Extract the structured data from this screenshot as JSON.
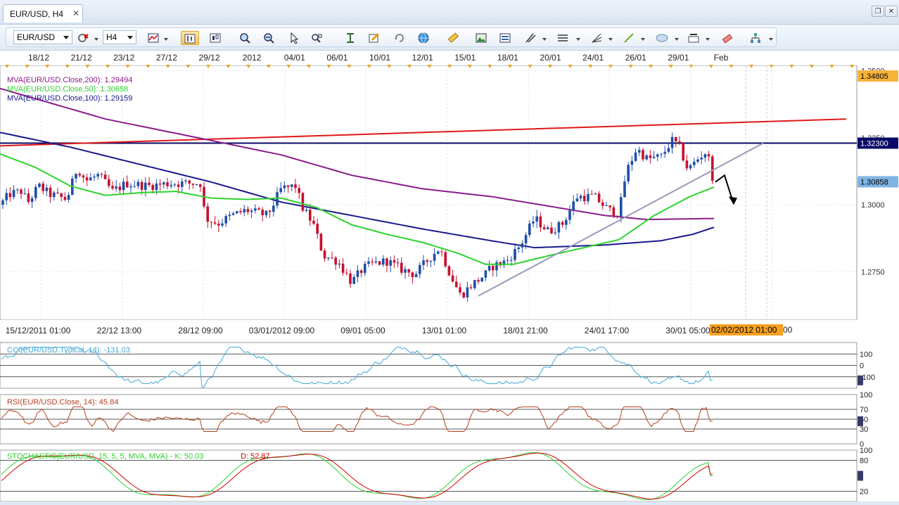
{
  "window": {
    "tab_label": "EUR/USD, H4",
    "close_glyph": "✕",
    "restore_glyph": "❐",
    "close_win_glyph": "✕"
  },
  "toolbar": {
    "symbol": "EUR/USD",
    "timeframe": "H4",
    "icons": [
      "indicator-icon",
      "crosshair-remove-icon",
      "chart-style-icon",
      "bar-chart-icon",
      "candle-chart-icon",
      "zoom-in-icon",
      "zoom-out-icon",
      "cursor-icon",
      "zoom-area-icon",
      "fit-icon",
      "edit-icon",
      "refresh-icon",
      "globe-icon",
      "ruler-icon",
      "picture-icon",
      "template-icon",
      "line-tools-icon",
      "hline-icon",
      "fan-icon",
      "trendline-icon",
      "ellipse-icon",
      "text-icon",
      "eraser-icon",
      "layout-icon"
    ]
  },
  "chart_data": [
    {
      "type": "candlestick",
      "symbol": "EUR/USD",
      "timeframe": "H4",
      "ylim": [
        1.257,
        1.352
      ],
      "y_ticks": [
        "1.2750",
        "1.3000",
        "1.3250",
        "1.3500"
      ],
      "top_dates": [
        "18/12",
        "21/12",
        "23/12",
        "27/12",
        "29/12",
        "2012",
        "04/01",
        "06/01",
        "10/01",
        "12/01",
        "15/01",
        "18/01",
        "20/01",
        "24/01",
        "26/01",
        "29/01",
        "Feb"
      ],
      "bottom_dates": [
        "15/12/2011 01:00",
        "22/12 13:00",
        "28/12 09:00",
        "03/01/2012 09:00",
        "09/01 05:00",
        "13/01 01:00",
        "18/01 21:00",
        "24/01 17:00",
        "30/01 05:00"
      ],
      "cursor_time_label": "02/02/2012 01:00",
      "price_labels": [
        {
          "value": "1.34805",
          "color": "#f7b33a"
        },
        {
          "value": "1.32300",
          "color": "#0a0a66"
        },
        {
          "value": "1.30858",
          "color": "#7fb3e3"
        }
      ],
      "indicators": [
        {
          "label": "MVA(EUR/USD.Close,200): 1.29494",
          "color": "#8b1c8b"
        },
        {
          "label": "MVA(EUR/USD.Close,50): 1.30658",
          "color": "#2fd12f"
        },
        {
          "label": "MVA(EUR/USD.Close,100): 1.29159",
          "color": "#1a1a8c"
        }
      ],
      "horizontal_line": 1.323,
      "red_line": {
        "start": 1.322,
        "end": 1.332
      },
      "ohlc_keyframes": [
        [
          0,
          1.3
        ],
        [
          14,
          1.304
        ],
        [
          30,
          1.305
        ],
        [
          40,
          1.301
        ],
        [
          55,
          1.307
        ],
        [
          70,
          1.304
        ],
        [
          95,
          1.302
        ],
        [
          110,
          1.314
        ],
        [
          122,
          1.309
        ],
        [
          140,
          1.311
        ],
        [
          160,
          1.305
        ],
        [
          180,
          1.308
        ],
        [
          210,
          1.307
        ],
        [
          240,
          1.308
        ],
        [
          285,
          1.308
        ],
        [
          292,
          1.295
        ],
        [
          310,
          1.293
        ],
        [
          330,
          1.296
        ],
        [
          350,
          1.298
        ],
        [
          380,
          1.296
        ],
        [
          400,
          1.306
        ],
        [
          420,
          1.307
        ],
        [
          430,
          1.299
        ],
        [
          445,
          1.293
        ],
        [
          460,
          1.281
        ],
        [
          480,
          1.279
        ],
        [
          500,
          1.271
        ],
        [
          515,
          1.276
        ],
        [
          530,
          1.278
        ],
        [
          550,
          1.279
        ],
        [
          570,
          1.276
        ],
        [
          590,
          1.274
        ],
        [
          610,
          1.28
        ],
        [
          625,
          1.284
        ],
        [
          640,
          1.274
        ],
        [
          655,
          1.266
        ],
        [
          670,
          1.27
        ],
        [
          690,
          1.274
        ],
        [
          700,
          1.277
        ],
        [
          720,
          1.279
        ],
        [
          740,
          1.285
        ],
        [
          760,
          1.295
        ],
        [
          780,
          1.29
        ],
        [
          800,
          1.293
        ],
        [
          820,
          1.303
        ],
        [
          845,
          1.303
        ],
        [
          865,
          1.298
        ],
        [
          880,
          1.297
        ],
        [
          890,
          1.312
        ],
        [
          905,
          1.321
        ],
        [
          920,
          1.317
        ],
        [
          940,
          1.318
        ],
        [
          955,
          1.324
        ],
        [
          965,
          1.322
        ],
        [
          978,
          1.313
        ],
        [
          995,
          1.318
        ],
        [
          1005,
          1.32
        ],
        [
          1015,
          1.308
        ]
      ],
      "ma200": [
        [
          0,
          1.3434
        ],
        [
          150,
          1.332
        ],
        [
          300,
          1.324
        ],
        [
          400,
          1.3186
        ],
        [
          500,
          1.311
        ],
        [
          600,
          1.306
        ],
        [
          700,
          1.303
        ],
        [
          780,
          1.2995
        ],
        [
          860,
          1.296
        ],
        [
          920,
          1.2945
        ],
        [
          1015,
          1.2949
        ]
      ],
      "ma100": [
        [
          0,
          1.327
        ],
        [
          100,
          1.3215
        ],
        [
          200,
          1.315
        ],
        [
          300,
          1.3085
        ],
        [
          400,
          1.301
        ],
        [
          500,
          1.296
        ],
        [
          600,
          1.291
        ],
        [
          700,
          1.2865
        ],
        [
          760,
          1.284
        ],
        [
          860,
          1.285
        ],
        [
          940,
          1.2866
        ],
        [
          985,
          1.289
        ],
        [
          1015,
          1.2916
        ]
      ],
      "ma50": [
        [
          0,
          1.319
        ],
        [
          50,
          1.314
        ],
        [
          100,
          1.307
        ],
        [
          150,
          1.3035
        ],
        [
          200,
          1.3045
        ],
        [
          250,
          1.305
        ],
        [
          300,
          1.3025
        ],
        [
          350,
          1.302
        ],
        [
          400,
          1.3025
        ],
        [
          450,
          1.299
        ],
        [
          500,
          1.2925
        ],
        [
          550,
          1.289
        ],
        [
          600,
          1.286
        ],
        [
          650,
          1.282
        ],
        [
          690,
          1.2778
        ],
        [
          730,
          1.2778
        ],
        [
          780,
          1.281
        ],
        [
          830,
          1.284
        ],
        [
          880,
          1.287
        ],
        [
          930,
          1.296
        ],
        [
          980,
          1.303
        ],
        [
          1015,
          1.3066
        ]
      ],
      "trendline": [
        [
          680,
          1.266
        ],
        [
          1085,
          1.323
        ]
      ],
      "arrow": [
        [
          1017,
          1.3085
        ],
        [
          1030,
          1.311
        ],
        [
          1042,
          1.301
        ]
      ]
    },
    {
      "type": "line",
      "name": "CCI",
      "label": "CCI(EUR/USD.Typical, 14): -131.03",
      "color": "#3fa9d9",
      "ylim": [
        -200,
        200
      ],
      "levels": [
        100,
        0,
        -100
      ],
      "tick_labels": [
        "100",
        "0",
        "-100"
      ],
      "last_value": -131.03
    },
    {
      "type": "line",
      "name": "RSI",
      "label": "RSI(EUR/USD.Close, 14): 45.84",
      "color": "#b5411f",
      "ylim": [
        0,
        100
      ],
      "levels": [
        70,
        50,
        30
      ],
      "tick_labels": [
        "100",
        "70",
        "50",
        "30",
        "0"
      ],
      "last_value": 45.84
    },
    {
      "type": "line",
      "name": "Stochastic",
      "label": "STOCHASTIC(EUR/USD, 15, 5, 5, MVA, MVA) -  K: 50.03",
      "label_d": "D: 52.87",
      "k_color": "#2fd12f",
      "d_color": "#d40000",
      "ylim": [
        0,
        100
      ],
      "levels": [
        80,
        20
      ],
      "tick_labels": [
        "100",
        "80",
        "20"
      ],
      "k_last": 50.03,
      "d_last": 52.87
    }
  ]
}
